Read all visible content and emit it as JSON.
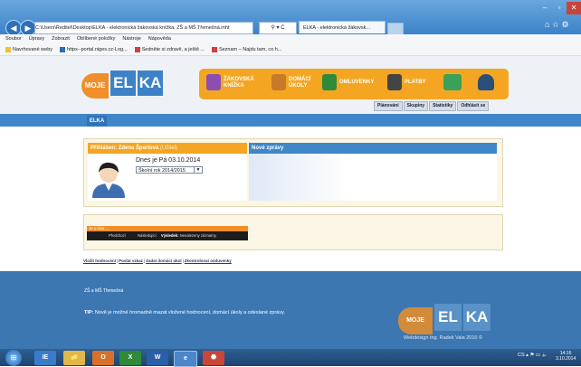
{
  "browser": {
    "address": "C:\\Users\\Ředitel\\Desktop\\ELKA - elektronická žákovská knížka, ZŠ a MŠ Třemešná.mht",
    "address_controls": "⚲ ▾ C",
    "tab_title": "ELKA - elektronická žákovsk...",
    "window_buttons": [
      "–",
      "▫",
      "✕"
    ],
    "toolbar_icons": "⌂ ☆ ⚙",
    "menu": [
      "Soubor",
      "Úpravy",
      "Zobrazit",
      "Oblíbené položky",
      "Nástroje",
      "Nápověda"
    ],
    "favorites": [
      "Navrhované weby",
      "https--portal.niges.cz-Log...",
      "Sedněte si zdravě, a ještě ...",
      "Seznam – Najdu tam, co h..."
    ]
  },
  "header": {
    "logo": {
      "moje": "MOJE",
      "el": "EL",
      "ka": "KA"
    },
    "nav": [
      {
        "label_1": "ŽÁKOVSKÁ",
        "label_2": "KNÍŽKA",
        "icon": "book-icon",
        "color": "#8a4fb0"
      },
      {
        "label_1": "DOMÁCÍ",
        "label_2": "ÚKOLY",
        "icon": "homework-icon",
        "color": "#c87a2a"
      },
      {
        "label_1": "OMLUVENKY",
        "label_2": "",
        "icon": "phone-icon",
        "color": "#2f8a3a"
      },
      {
        "label_1": "PLATBY",
        "label_2": "",
        "icon": "calculator-icon",
        "color": "#444444"
      },
      {
        "label_1": "",
        "label_2": "",
        "icon": "message-icon",
        "color": "#3aa05a"
      },
      {
        "label_1": "",
        "label_2": "",
        "icon": "user-icon",
        "color": "#2a4f7a"
      }
    ],
    "subnav": [
      "Plánování",
      "Skupiny",
      "Statistiky",
      "Odhlásit se"
    ]
  },
  "section_tab": "ELKA",
  "user_panel": {
    "title_prefix": "Přihlášen: ",
    "name": "Zdena Šperlová",
    "role": "(Učitel)",
    "today": "Dnes je Pá 03.10.2014",
    "school_year": "Školní rok 2014/2015"
  },
  "news_panel": {
    "title": "Nové zprávy"
  },
  "week_widget": {
    "title": "Je u nás ...",
    "prev": "Předchozí",
    "next": "Následující",
    "label": "Výsledek:",
    "value": "Nenalezeny záznamy."
  },
  "links": [
    "Vložit hodnocení",
    "Poslat vzkaz",
    "Zadat domácí úkol",
    "Zkontrolovat omluvenky"
  ],
  "footer": {
    "school": "ZŠ a MŠ Třemešná",
    "tip_label": "TIP:",
    "tip_text": " Nově je možné hromadně mazat vložené hodnocení, domácí úkoly a odeslané zprávy.",
    "credit": "Webdesign Ing. Radek Vala 2010 ©"
  },
  "taskbar": {
    "apps": [
      "IE",
      "📁",
      "O",
      "X",
      "W",
      "e",
      "⬣"
    ],
    "tray": "CS ▴ ⚑ ▭ 🔈",
    "time": "14:16",
    "date": "3.10.2014"
  },
  "colors": {
    "accent_blue": "#3f86c9",
    "accent_orange": "#f4a623",
    "footer_blue": "#3c77b1"
  }
}
